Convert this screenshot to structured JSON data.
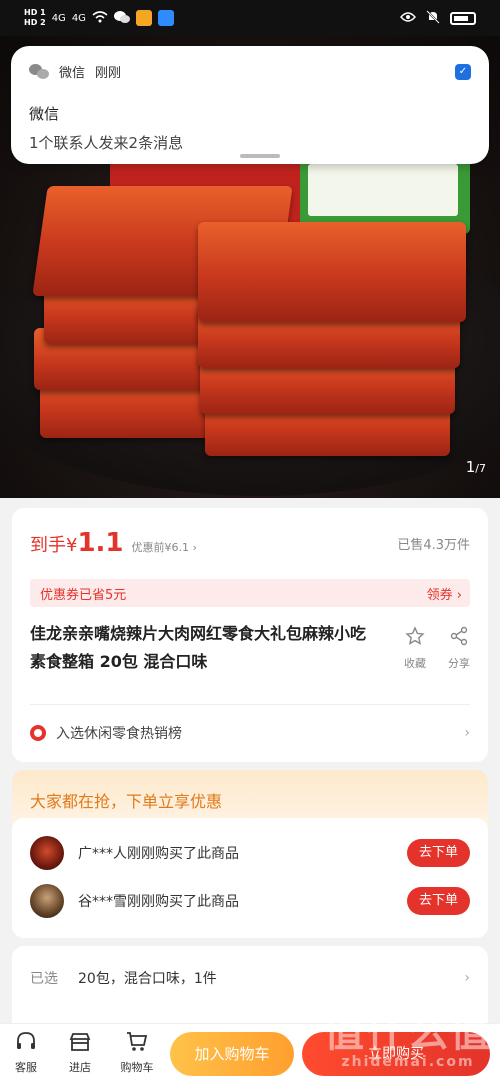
{
  "status_bar": {
    "sim1": "HD 1",
    "sim2": "HD 2",
    "net1": "4G",
    "net2": "4G",
    "colors": {
      "app1": "#f5a623",
      "app2": "#2f8cff"
    }
  },
  "notification": {
    "app": "微信",
    "time": "刚刚",
    "title": "微信",
    "body": "1个联系人发来2条消息"
  },
  "hero": {
    "page_current": "1",
    "page_total": "/7"
  },
  "price": {
    "label": "到手",
    "currency": "¥",
    "value": "1.1",
    "original": "优惠前¥6.1 ›",
    "sold": "已售4.3万件"
  },
  "coupon": {
    "text": "优惠券已省5元",
    "action": "领券 ›"
  },
  "product": {
    "title": "佳龙亲亲嘴烧辣片大肉网红零食大礼包麻辣小吃素食整箱 20包 混合口味"
  },
  "actions": {
    "favorite": "收藏",
    "share": "分享"
  },
  "rank": {
    "text": "入选休闲零食热销榜",
    "chevron": "›"
  },
  "promo": {
    "header": "大家都在抢，下单立享优惠",
    "buyers": [
      {
        "text": "广***人刚刚购买了此商品",
        "button": "去下单"
      },
      {
        "text": "谷***雪刚刚购买了此商品",
        "button": "去下单"
      }
    ]
  },
  "spec": {
    "label": "已选",
    "value": "20包，混合口味，1件",
    "chevron": "›"
  },
  "bottom_nav": {
    "service": "客服",
    "shop": "进店",
    "cart": "购物车"
  },
  "buttons": {
    "add_cart": "加入购物车",
    "buy_now": "立即购买"
  },
  "watermark": {
    "text": "值什么值",
    "sub": "zhidemai.com"
  },
  "colors": {
    "accent": "#e3332b",
    "orange": "#ff9f2e",
    "promo_text": "#e07a1a"
  }
}
